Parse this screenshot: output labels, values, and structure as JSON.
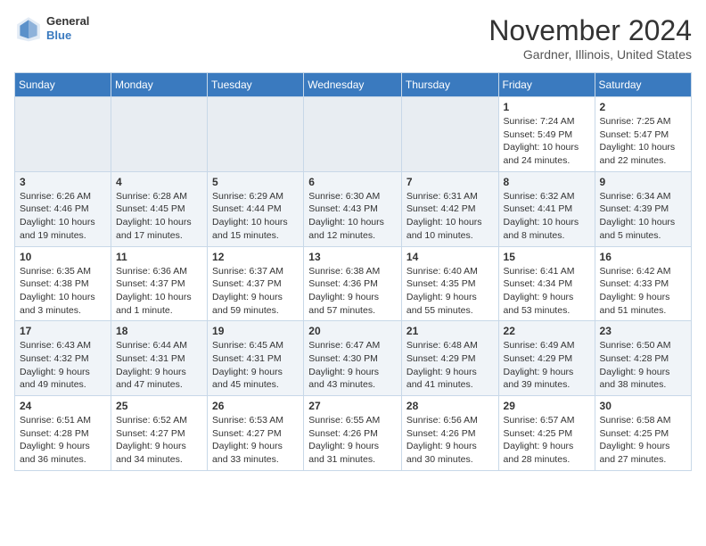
{
  "header": {
    "logo": {
      "general": "General",
      "blue": "Blue"
    },
    "title": "November 2024",
    "location": "Gardner, Illinois, United States"
  },
  "days_of_week": [
    "Sunday",
    "Monday",
    "Tuesday",
    "Wednesday",
    "Thursday",
    "Friday",
    "Saturday"
  ],
  "weeks": [
    [
      {
        "day": "",
        "info": ""
      },
      {
        "day": "",
        "info": ""
      },
      {
        "day": "",
        "info": ""
      },
      {
        "day": "",
        "info": ""
      },
      {
        "day": "",
        "info": ""
      },
      {
        "day": "1",
        "info": "Sunrise: 7:24 AM\nSunset: 5:49 PM\nDaylight: 10 hours and 24 minutes."
      },
      {
        "day": "2",
        "info": "Sunrise: 7:25 AM\nSunset: 5:47 PM\nDaylight: 10 hours and 22 minutes."
      }
    ],
    [
      {
        "day": "3",
        "info": "Sunrise: 6:26 AM\nSunset: 4:46 PM\nDaylight: 10 hours and 19 minutes."
      },
      {
        "day": "4",
        "info": "Sunrise: 6:28 AM\nSunset: 4:45 PM\nDaylight: 10 hours and 17 minutes."
      },
      {
        "day": "5",
        "info": "Sunrise: 6:29 AM\nSunset: 4:44 PM\nDaylight: 10 hours and 15 minutes."
      },
      {
        "day": "6",
        "info": "Sunrise: 6:30 AM\nSunset: 4:43 PM\nDaylight: 10 hours and 12 minutes."
      },
      {
        "day": "7",
        "info": "Sunrise: 6:31 AM\nSunset: 4:42 PM\nDaylight: 10 hours and 10 minutes."
      },
      {
        "day": "8",
        "info": "Sunrise: 6:32 AM\nSunset: 4:41 PM\nDaylight: 10 hours and 8 minutes."
      },
      {
        "day": "9",
        "info": "Sunrise: 6:34 AM\nSunset: 4:39 PM\nDaylight: 10 hours and 5 minutes."
      }
    ],
    [
      {
        "day": "10",
        "info": "Sunrise: 6:35 AM\nSunset: 4:38 PM\nDaylight: 10 hours and 3 minutes."
      },
      {
        "day": "11",
        "info": "Sunrise: 6:36 AM\nSunset: 4:37 PM\nDaylight: 10 hours and 1 minute."
      },
      {
        "day": "12",
        "info": "Sunrise: 6:37 AM\nSunset: 4:37 PM\nDaylight: 9 hours and 59 minutes."
      },
      {
        "day": "13",
        "info": "Sunrise: 6:38 AM\nSunset: 4:36 PM\nDaylight: 9 hours and 57 minutes."
      },
      {
        "day": "14",
        "info": "Sunrise: 6:40 AM\nSunset: 4:35 PM\nDaylight: 9 hours and 55 minutes."
      },
      {
        "day": "15",
        "info": "Sunrise: 6:41 AM\nSunset: 4:34 PM\nDaylight: 9 hours and 53 minutes."
      },
      {
        "day": "16",
        "info": "Sunrise: 6:42 AM\nSunset: 4:33 PM\nDaylight: 9 hours and 51 minutes."
      }
    ],
    [
      {
        "day": "17",
        "info": "Sunrise: 6:43 AM\nSunset: 4:32 PM\nDaylight: 9 hours and 49 minutes."
      },
      {
        "day": "18",
        "info": "Sunrise: 6:44 AM\nSunset: 4:31 PM\nDaylight: 9 hours and 47 minutes."
      },
      {
        "day": "19",
        "info": "Sunrise: 6:45 AM\nSunset: 4:31 PM\nDaylight: 9 hours and 45 minutes."
      },
      {
        "day": "20",
        "info": "Sunrise: 6:47 AM\nSunset: 4:30 PM\nDaylight: 9 hours and 43 minutes."
      },
      {
        "day": "21",
        "info": "Sunrise: 6:48 AM\nSunset: 4:29 PM\nDaylight: 9 hours and 41 minutes."
      },
      {
        "day": "22",
        "info": "Sunrise: 6:49 AM\nSunset: 4:29 PM\nDaylight: 9 hours and 39 minutes."
      },
      {
        "day": "23",
        "info": "Sunrise: 6:50 AM\nSunset: 4:28 PM\nDaylight: 9 hours and 38 minutes."
      }
    ],
    [
      {
        "day": "24",
        "info": "Sunrise: 6:51 AM\nSunset: 4:28 PM\nDaylight: 9 hours and 36 minutes."
      },
      {
        "day": "25",
        "info": "Sunrise: 6:52 AM\nSunset: 4:27 PM\nDaylight: 9 hours and 34 minutes."
      },
      {
        "day": "26",
        "info": "Sunrise: 6:53 AM\nSunset: 4:27 PM\nDaylight: 9 hours and 33 minutes."
      },
      {
        "day": "27",
        "info": "Sunrise: 6:55 AM\nSunset: 4:26 PM\nDaylight: 9 hours and 31 minutes."
      },
      {
        "day": "28",
        "info": "Sunrise: 6:56 AM\nSunset: 4:26 PM\nDaylight: 9 hours and 30 minutes."
      },
      {
        "day": "29",
        "info": "Sunrise: 6:57 AM\nSunset: 4:25 PM\nDaylight: 9 hours and 28 minutes."
      },
      {
        "day": "30",
        "info": "Sunrise: 6:58 AM\nSunset: 4:25 PM\nDaylight: 9 hours and 27 minutes."
      }
    ]
  ]
}
